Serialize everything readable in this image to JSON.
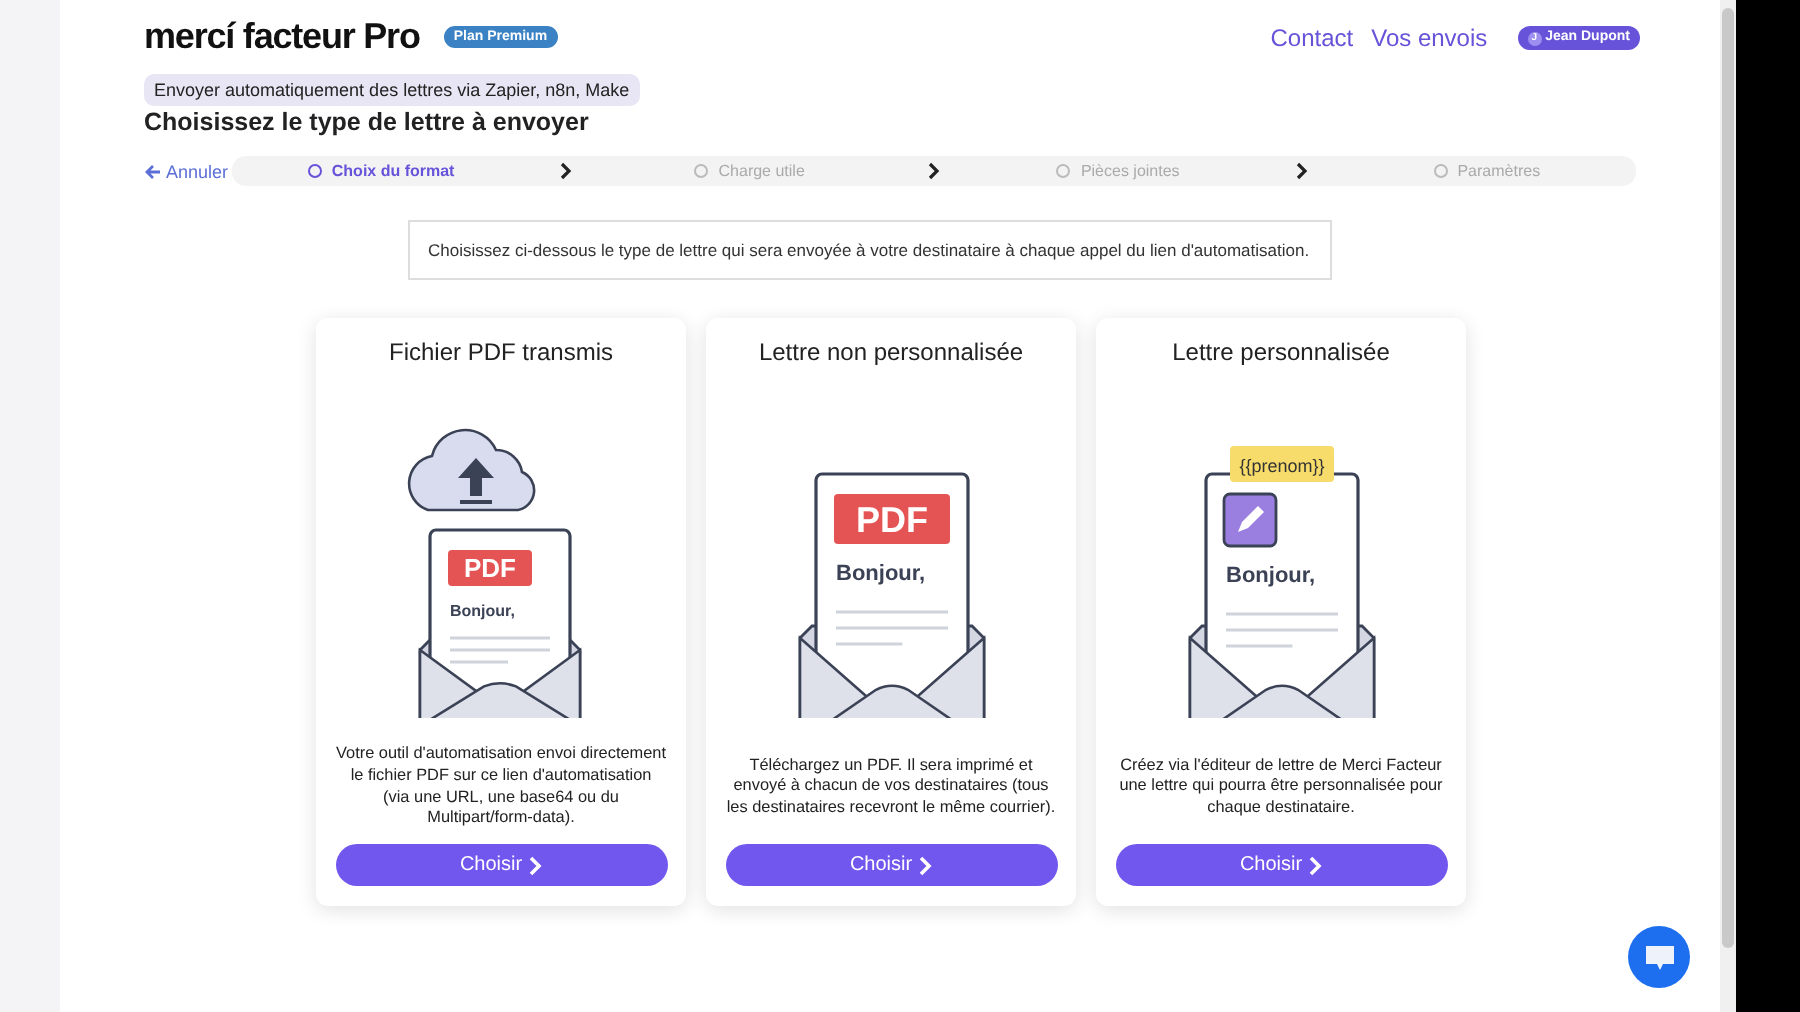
{
  "header": {
    "logo": "mercí facteur Pro",
    "plan_badge": "Plan Premium",
    "nav_links": [
      "Contact",
      "Vos envois"
    ],
    "user": {
      "initial": "J",
      "name": "Jean Dupont"
    }
  },
  "page": {
    "context_tag": "Envoyer automatiquement des lettres via Zapier, n8n, Make",
    "title": "Choisissez le type de lettre à envoyer"
  },
  "stepper": {
    "cancel": "Annuler",
    "steps": [
      {
        "label": "Choix du format",
        "selected": true
      },
      {
        "label": "Charge utile",
        "selected": false
      },
      {
        "label": "Pièces jointes",
        "selected": false
      },
      {
        "label": "Paramètres",
        "selected": false
      }
    ]
  },
  "intro": "Choisissez ci-dessous le type de lettre qui sera envoyée à votre destinataire à chaque appel du lien d'automatisation.",
  "cards": [
    {
      "kind": "upload",
      "title": "Fichier PDF transmis",
      "illustration": {
        "badge": "PDF",
        "greeting": "Bonjour,"
      },
      "description": "Votre outil d'automatisation envoi directement le fichier PDF sur ce lien d'automatisation (via une URL, une base64 ou du Multipart/form-data).",
      "button": "Choisir"
    },
    {
      "kind": "pdf",
      "title": "Lettre non personnalisée",
      "illustration": {
        "badge": "PDF",
        "greeting": "Bonjour,"
      },
      "description": "Téléchargez un PDF. Il sera imprimé et envoyé à chacun de vos destinataires (tous les destinataires recevront le même courrier).",
      "button": "Choisir"
    },
    {
      "kind": "custom",
      "title": "Lettre personnalisée",
      "illustration": {
        "tag": "{{prenom}}",
        "greeting": "Bonjour,"
      },
      "description": "Créez via l'éditeur de lettre de Merci Facteur une lettre qui pourra être personnalisée pour chaque destinataire.",
      "button": "Choisir"
    }
  ]
}
